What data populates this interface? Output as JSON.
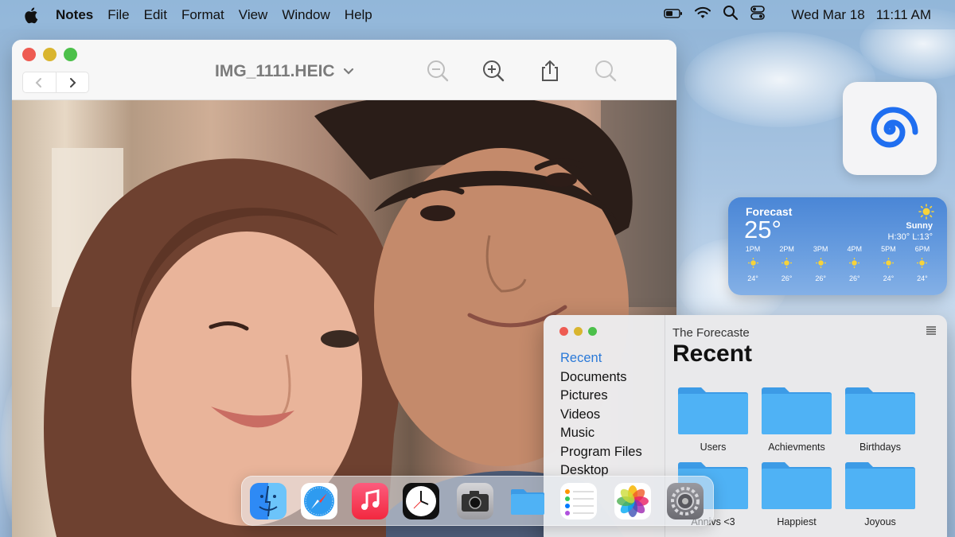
{
  "menubar": {
    "app_name": "Notes",
    "menus": [
      "File",
      "Edit",
      "Format",
      "View",
      "Window",
      "Help"
    ],
    "date": "Wed Mar 18",
    "time": "11:11 AM"
  },
  "preview": {
    "title": "IMG_1111.HEIC",
    "toolbar_icons": [
      "zoom-out-icon",
      "zoom-in-icon",
      "share-icon",
      "search-icon"
    ]
  },
  "weather": {
    "title": "Forecast",
    "temperature": "25°",
    "condition": "Sunny",
    "high_low": "H:30° L:13°",
    "hours": [
      {
        "time": "1PM",
        "temp": "24°"
      },
      {
        "time": "2PM",
        "temp": "26°"
      },
      {
        "time": "3PM",
        "temp": "26°"
      },
      {
        "time": "4PM",
        "temp": "26°"
      },
      {
        "time": "5PM",
        "temp": "24°"
      },
      {
        "time": "6PM",
        "temp": "24°"
      }
    ]
  },
  "finder": {
    "sidebar": [
      "Recent",
      "Documents",
      "Pictures",
      "Videos",
      "Music",
      "Program Files",
      "Desktop"
    ],
    "active_item": "Recent",
    "breadcrumb": "The Forecaste",
    "heading": "Recent",
    "folders": [
      "Users",
      "Achievments",
      "Birthdays",
      "Annivs <3",
      "Happiest",
      "Joyous"
    ]
  },
  "dock": {
    "apps": [
      "finder-icon",
      "safari-icon",
      "music-icon",
      "clock-icon",
      "camera-icon",
      "files-icon",
      "reminders-icon",
      "photos-icon",
      "settings-icon"
    ]
  },
  "colors": {
    "accent": "#2a79d8",
    "folder": "#4fb2f5",
    "folder_tab": "#3c9be6"
  }
}
